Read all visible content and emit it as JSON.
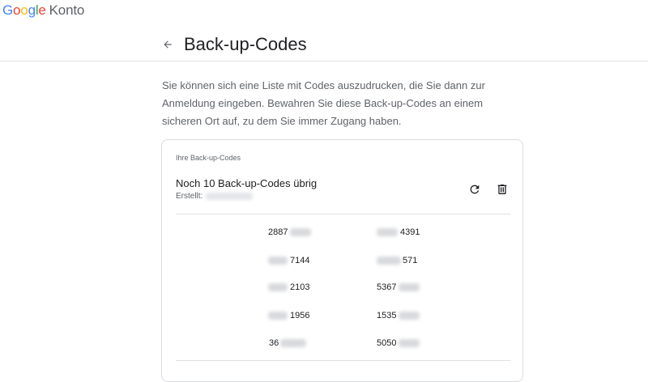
{
  "brand": {
    "google_letters": [
      "G",
      "o",
      "o",
      "g",
      "l",
      "e"
    ],
    "product": "Konto"
  },
  "header": {
    "title": "Back-up-Codes",
    "back_icon": "arrow-left-icon"
  },
  "description": "Sie können sich eine Liste mit Codes auszudrucken, die Sie dann zur Anmeldung eingeben. Bewahren Sie diese Back-up-Codes an einem sicheren Ort auf, zu dem Sie immer Zugang haben.",
  "card": {
    "label": "Ihre Back-up-Codes",
    "count_text": "Noch 10 Back-up-Codes übrig",
    "created_label": "Erstellt:",
    "refresh_icon": "refresh-icon",
    "delete_icon": "trash-icon"
  },
  "codes": [
    {
      "clear_prefix": "2887",
      "clear_suffix": ""
    },
    {
      "clear_prefix": "",
      "clear_suffix": "4391"
    },
    {
      "clear_prefix": "",
      "clear_suffix": "7144"
    },
    {
      "clear_prefix": "",
      "clear_suffix": "571"
    },
    {
      "clear_prefix": "",
      "clear_suffix": "2103"
    },
    {
      "clear_prefix": "5367",
      "clear_suffix": ""
    },
    {
      "clear_prefix": "",
      "clear_suffix": "1956"
    },
    {
      "clear_prefix": "1535",
      "clear_suffix": ""
    },
    {
      "clear_prefix": "36",
      "clear_suffix": ""
    },
    {
      "clear_prefix": "5050",
      "clear_suffix": ""
    }
  ],
  "colors": {
    "google_blue": "#4285F4",
    "google_red": "#EA4335",
    "google_yellow": "#FBBC05",
    "google_green": "#34A853",
    "text_primary": "#202124",
    "text_secondary": "#5f6368",
    "border": "#dadce0"
  }
}
